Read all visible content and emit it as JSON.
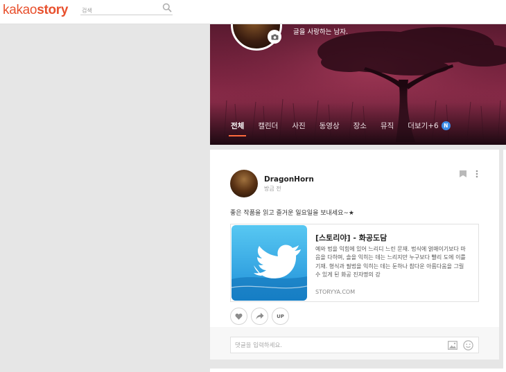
{
  "header": {
    "logo_light": "kakao",
    "logo_bold": "story",
    "search_placeholder": "검색"
  },
  "profile": {
    "bio": "글을 사랑하는 남자."
  },
  "tabs": [
    {
      "label": "전체",
      "active": true
    },
    {
      "label": "캘린더"
    },
    {
      "label": "사진"
    },
    {
      "label": "동영상"
    },
    {
      "label": "장소"
    },
    {
      "label": "뮤직"
    },
    {
      "label": "더보기+6"
    }
  ],
  "tab_badge": "N",
  "post": {
    "author": "DragonHorn",
    "time": "방금 전",
    "text": "좋은 작품을 읽고 즐거운 일요일을 보내세요~★",
    "link": {
      "title": "[스토리야] - 화공도담",
      "description": "예와 법을 익힘에 있어 느리디 느린 문재. 법식에 얽매이기보다 마음을 다하며, 솔을 익히는 데는 느리지만 누구보다 빨리 도에 이를 기재. 형식과 필법을 익히는 데는 둔하나 참다운 아름다움을 그릴 수 있게 된 화공 진자명의 강",
      "domain": "STORYYA.COM"
    },
    "actions": {
      "up_label": "UP"
    },
    "comment_placeholder": "댓글을 입력하세요."
  },
  "colors": {
    "brand": "#e8512e",
    "tab_underline": "#ff6a3d",
    "badge": "#3b8be6"
  }
}
